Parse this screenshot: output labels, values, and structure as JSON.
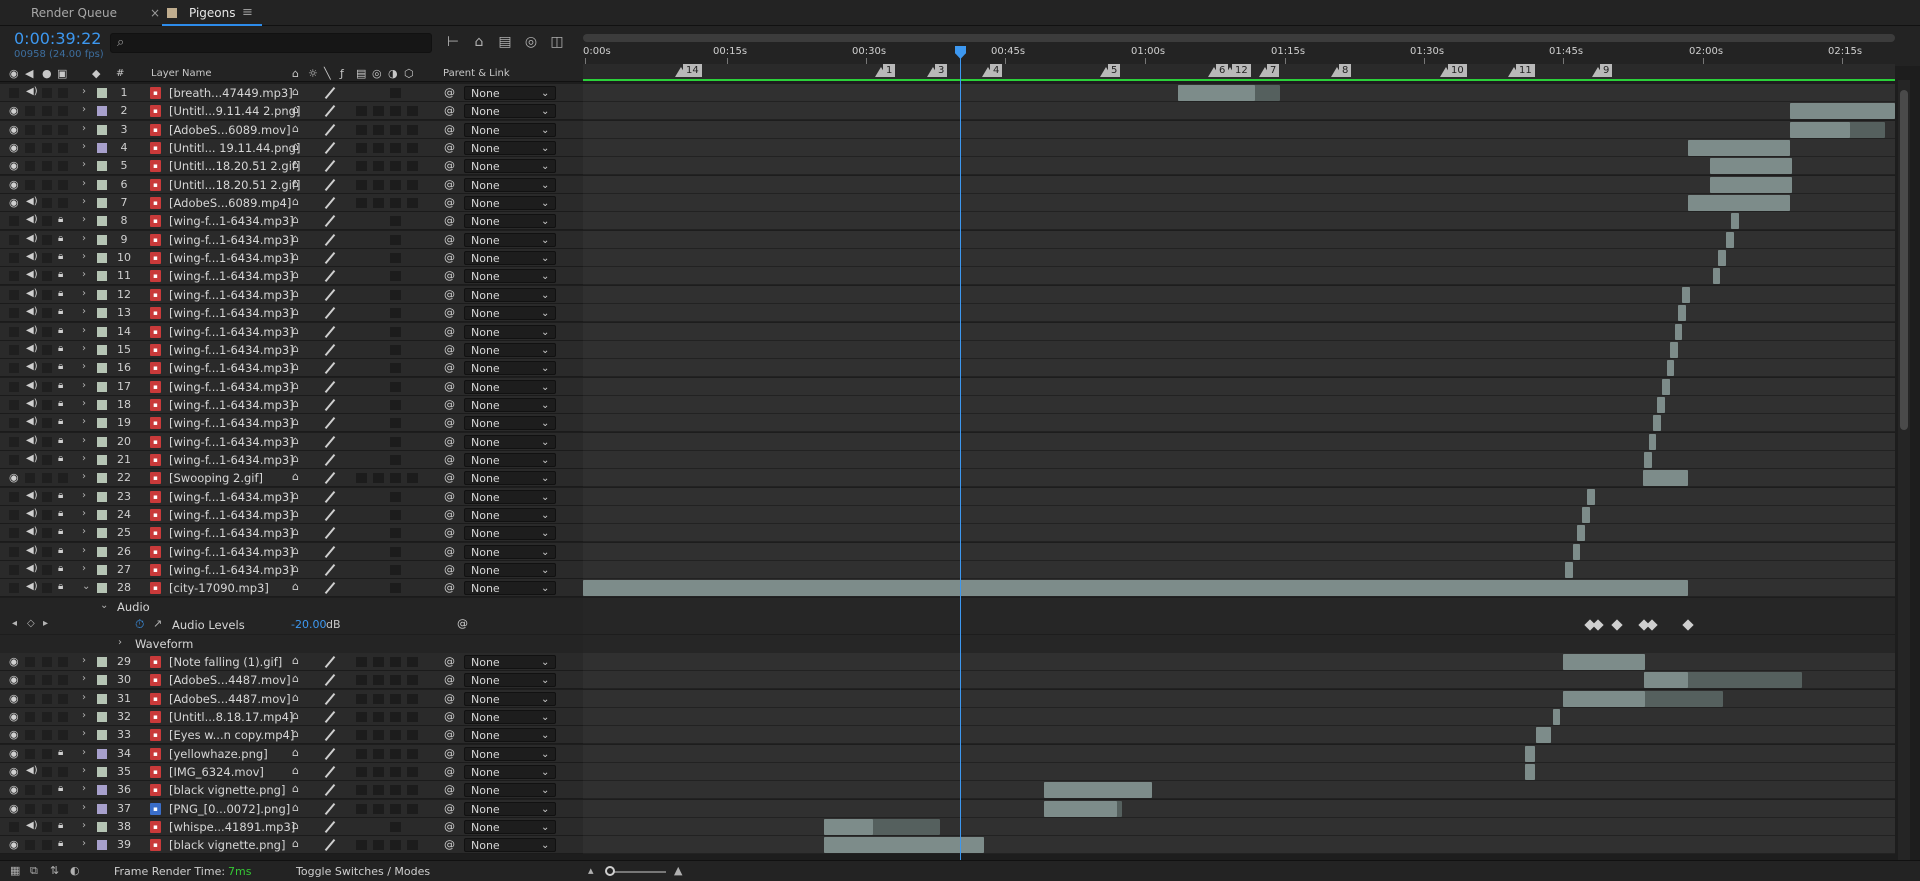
{
  "tabs": [
    {
      "label": "Render Queue",
      "active": false
    },
    {
      "label": "Pigeons",
      "active": true
    }
  ],
  "timecode": "0:00:39:22",
  "frame_info": "00958 (24.00 fps)",
  "search_placeholder": "",
  "columns": {
    "hash": "#",
    "layer_name": "Layer Name",
    "parent_link": "Parent & Link"
  },
  "ruler_ticks": [
    "0:00s",
    "00:15s",
    "00:30s",
    "00:45s",
    "01:00s",
    "01:15s",
    "01:30s",
    "01:45s",
    "02:00s",
    "02:15s"
  ],
  "markers": [
    "14",
    "1",
    "3",
    "4",
    "5",
    "6",
    "12",
    "7",
    "8",
    "10",
    "11",
    "9"
  ],
  "layers": [
    {
      "num": "1",
      "name": "[breath...47449.mp3]",
      "type": "audio",
      "label": "#b5c4b4",
      "eye": false,
      "spk": true,
      "lock": false
    },
    {
      "num": "2",
      "name": "[Untitl...9.11.44 2.png]",
      "type": "image",
      "label": "#a7a0cc",
      "eye": true,
      "spk": false,
      "lock": false
    },
    {
      "num": "3",
      "name": "[AdobeS...6089.mov]",
      "type": "video",
      "label": "#b5c4b4",
      "eye": true,
      "spk": false,
      "lock": false
    },
    {
      "num": "4",
      "name": "[Untitl... 19.11.44.png]",
      "type": "image",
      "label": "#a7a0cc",
      "eye": true,
      "spk": false,
      "lock": false
    },
    {
      "num": "5",
      "name": "[Untitl...18.20.51 2.gif]",
      "type": "image",
      "label": "#b5c4b4",
      "eye": true,
      "spk": false,
      "lock": false
    },
    {
      "num": "6",
      "name": "[Untitl...18.20.51 2.gif]",
      "type": "image",
      "label": "#b5c4b4",
      "eye": true,
      "spk": false,
      "lock": false
    },
    {
      "num": "7",
      "name": "[AdobeS...6089.mp4]",
      "type": "video",
      "label": "#b5c4b4",
      "eye": true,
      "spk": true,
      "lock": false
    },
    {
      "num": "8",
      "name": "[wing-f...1-6434.mp3]",
      "type": "audio",
      "label": "#b5c4b4",
      "eye": false,
      "spk": true,
      "lock": true
    },
    {
      "num": "9",
      "name": "[wing-f...1-6434.mp3]",
      "type": "audio",
      "label": "#b5c4b4",
      "eye": false,
      "spk": true,
      "lock": true
    },
    {
      "num": "10",
      "name": "[wing-f...1-6434.mp3]",
      "type": "audio",
      "label": "#b5c4b4",
      "eye": false,
      "spk": true,
      "lock": true
    },
    {
      "num": "11",
      "name": "[wing-f...1-6434.mp3]",
      "type": "audio",
      "label": "#b5c4b4",
      "eye": false,
      "spk": true,
      "lock": true
    },
    {
      "num": "12",
      "name": "[wing-f...1-6434.mp3]",
      "type": "audio",
      "label": "#b5c4b4",
      "eye": false,
      "spk": true,
      "lock": true
    },
    {
      "num": "13",
      "name": "[wing-f...1-6434.mp3]",
      "type": "audio",
      "label": "#b5c4b4",
      "eye": false,
      "spk": true,
      "lock": true
    },
    {
      "num": "14",
      "name": "[wing-f...1-6434.mp3]",
      "type": "audio",
      "label": "#b5c4b4",
      "eye": false,
      "spk": true,
      "lock": true
    },
    {
      "num": "15",
      "name": "[wing-f...1-6434.mp3]",
      "type": "audio",
      "label": "#b5c4b4",
      "eye": false,
      "spk": true,
      "lock": true
    },
    {
      "num": "16",
      "name": "[wing-f...1-6434.mp3]",
      "type": "audio",
      "label": "#b5c4b4",
      "eye": false,
      "spk": true,
      "lock": true
    },
    {
      "num": "17",
      "name": "[wing-f...1-6434.mp3]",
      "type": "audio",
      "label": "#b5c4b4",
      "eye": false,
      "spk": true,
      "lock": true
    },
    {
      "num": "18",
      "name": "[wing-f...1-6434.mp3]",
      "type": "audio",
      "label": "#b5c4b4",
      "eye": false,
      "spk": true,
      "lock": true
    },
    {
      "num": "19",
      "name": "[wing-f...1-6434.mp3]",
      "type": "audio",
      "label": "#b5c4b4",
      "eye": false,
      "spk": true,
      "lock": true
    },
    {
      "num": "20",
      "name": "[wing-f...1-6434.mp3]",
      "type": "audio",
      "label": "#b5c4b4",
      "eye": false,
      "spk": true,
      "lock": true
    },
    {
      "num": "21",
      "name": "[wing-f...1-6434.mp3]",
      "type": "audio",
      "label": "#b5c4b4",
      "eye": false,
      "spk": true,
      "lock": true
    },
    {
      "num": "22",
      "name": "[Swooping 2.gif]",
      "type": "image",
      "label": "#b5c4b4",
      "eye": true,
      "spk": false,
      "lock": false
    },
    {
      "num": "23",
      "name": "[wing-f...1-6434.mp3]",
      "type": "audio",
      "label": "#b5c4b4",
      "eye": false,
      "spk": true,
      "lock": true
    },
    {
      "num": "24",
      "name": "[wing-f...1-6434.mp3]",
      "type": "audio",
      "label": "#b5c4b4",
      "eye": false,
      "spk": true,
      "lock": true
    },
    {
      "num": "25",
      "name": "[wing-f...1-6434.mp3]",
      "type": "audio",
      "label": "#b5c4b4",
      "eye": false,
      "spk": true,
      "lock": true
    },
    {
      "num": "26",
      "name": "[wing-f...1-6434.mp3]",
      "type": "audio",
      "label": "#b5c4b4",
      "eye": false,
      "spk": true,
      "lock": true
    },
    {
      "num": "27",
      "name": "[wing-f...1-6434.mp3]",
      "type": "audio",
      "label": "#b5c4b4",
      "eye": false,
      "spk": true,
      "lock": true
    },
    {
      "num": "28",
      "name": "[city-17090.mp3]",
      "type": "audio",
      "label": "#b5c4b4",
      "eye": false,
      "spk": true,
      "lock": true
    },
    {
      "num": "29",
      "name": "[Note falling (1).gif]",
      "type": "image",
      "label": "#b5c4b4",
      "eye": true,
      "spk": false,
      "lock": false
    },
    {
      "num": "30",
      "name": "[AdobeS...4487.mov]",
      "type": "video",
      "label": "#b5c4b4",
      "eye": true,
      "spk": false,
      "lock": false
    },
    {
      "num": "31",
      "name": "[AdobeS...4487.mov]",
      "type": "video",
      "label": "#b5c4b4",
      "eye": true,
      "spk": false,
      "lock": false
    },
    {
      "num": "32",
      "name": "[Untitl...8.18.17.mp4]",
      "type": "video",
      "label": "#b5c4b4",
      "eye": true,
      "spk": false,
      "lock": false
    },
    {
      "num": "33",
      "name": "[Eyes w...n copy.mp4]",
      "type": "video",
      "label": "#b5c4b4",
      "eye": true,
      "spk": false,
      "lock": false
    },
    {
      "num": "34",
      "name": "[yellowhaze.png]",
      "type": "image",
      "label": "#a7a0cc",
      "eye": true,
      "spk": false,
      "lock": true
    },
    {
      "num": "35",
      "name": "[IMG_6324.mov]",
      "type": "video",
      "label": "#b5c4b4",
      "eye": true,
      "spk": true,
      "lock": false
    },
    {
      "num": "36",
      "name": "[black vignette.png]",
      "type": "image",
      "label": "#a7a0cc",
      "eye": true,
      "spk": false,
      "lock": true
    },
    {
      "num": "37",
      "name": "[PNG_[0...0072].png]",
      "type": "sequence",
      "label": "#a7a0cc",
      "eye": true,
      "spk": false,
      "lock": false
    },
    {
      "num": "38",
      "name": "[whispe...41891.mp3]",
      "type": "audio",
      "label": "#b5c4b4",
      "eye": false,
      "spk": true,
      "lock": true
    },
    {
      "num": "39",
      "name": "[black vignette.png]",
      "type": "image",
      "label": "#a7a0cc",
      "eye": true,
      "spk": false,
      "lock": true
    }
  ],
  "parent_value": "None",
  "audio_group": {
    "label": "Audio",
    "property": "Audio Levels",
    "value": "-20.00",
    "unit": "dB",
    "waveform": "Waveform"
  },
  "footer": {
    "frame_render_label": "Frame Render Time:",
    "frame_render_value": "7ms",
    "toggle_label": "Toggle Switches / Modes"
  },
  "colors": {
    "accent": "#3d98f0",
    "green": "#2bd13a",
    "clip": "#55605e",
    "clip_active": "#7d8c8a"
  }
}
